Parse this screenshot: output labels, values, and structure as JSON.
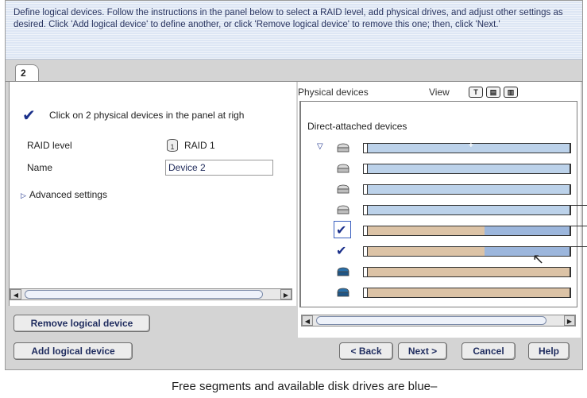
{
  "banner": {
    "text": "Define logical devices.  Follow the instructions in the panel below to select a RAID level, add physical drives, and adjust other settings as desired.  Click 'Add logical device' to define another, or click 'Remove logical device' to remove this one; then, click 'Next.'"
  },
  "tab": {
    "label": "2"
  },
  "left": {
    "instruction": "Click on 2 physical devices in the panel at righ",
    "raid_label": "RAID level",
    "raid_icon_text": "1",
    "raid_value": "RAID 1",
    "name_label": "Name",
    "name_value": "Device 2",
    "advanced_label": "Advanced settings",
    "remove_button": "Remove logical device"
  },
  "right": {
    "title": "Physical devices",
    "view_label": "View",
    "view_buttons": [
      "T",
      "▤",
      "▥"
    ],
    "group_title": "Direct-attached devices",
    "plus_marker": "+",
    "devices": [
      {
        "icon": "disk-icon",
        "state": "free",
        "used_fraction": 0
      },
      {
        "icon": "disk-icon",
        "state": "free",
        "used_fraction": 0
      },
      {
        "icon": "disk-icon",
        "state": "free",
        "used_fraction": 0
      },
      {
        "icon": "disk-icon",
        "state": "free",
        "used_fraction": 0
      },
      {
        "icon": "check-icon",
        "state": "selected",
        "used_fraction": 0.58
      },
      {
        "icon": "check-icon",
        "state": "selected",
        "used_fraction": 0.58
      },
      {
        "icon": "disk-icon",
        "state": "used",
        "used_fraction": 1
      },
      {
        "icon": "disk-icon",
        "state": "used",
        "used_fraction": 1
      }
    ]
  },
  "footer": {
    "add_button": "Add logical device",
    "back_button": "< Back",
    "next_button": "Next >",
    "cancel_button": "Cancel",
    "help_button": "Help"
  },
  "caption": "Free segments and available disk drives are blue–",
  "colors": {
    "banner_bg": "#dde6f4",
    "free_blue": "#bcd2ea",
    "used_tan": "#dcc3a6",
    "accent_navy": "#1a2f8a"
  }
}
